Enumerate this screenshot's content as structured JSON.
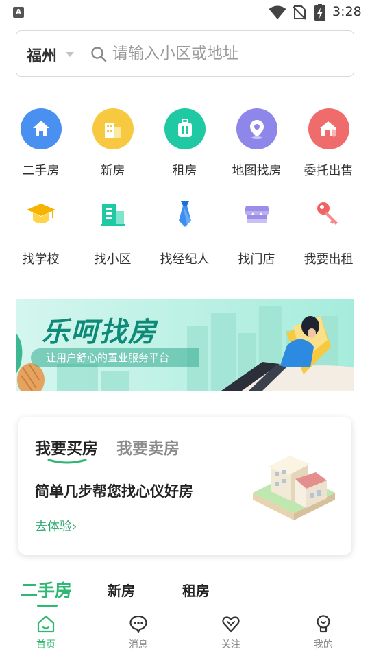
{
  "status_bar": {
    "time": "3:28",
    "app_badge": "A"
  },
  "search": {
    "city": "福州",
    "placeholder": "请输入小区或地址"
  },
  "categories": [
    {
      "label": "二手房",
      "icon": "house-icon",
      "color": "#4a90f0"
    },
    {
      "label": "新房",
      "icon": "building-icon",
      "color": "#f7c940"
    },
    {
      "label": "租房",
      "icon": "luggage-icon",
      "color": "#1ec9a3"
    },
    {
      "label": "地图找房",
      "icon": "map-pin-icon",
      "color": "#8e86e8"
    },
    {
      "label": "委托出售",
      "icon": "house-shield-icon",
      "color": "#f06b6b"
    },
    {
      "label": "找学校",
      "icon": "graduation-cap-icon",
      "color": "#f5b400"
    },
    {
      "label": "找小区",
      "icon": "apartment-icon",
      "color": "#1ec9a3"
    },
    {
      "label": "找经纪人",
      "icon": "tie-icon",
      "color": "#3c8ef0"
    },
    {
      "label": "找门店",
      "icon": "storefront-icon",
      "color": "#9b8ee8"
    },
    {
      "label": "我要出租",
      "icon": "key-icon",
      "color": "#f26262"
    }
  ],
  "banner": {
    "title": "乐呵找房",
    "subtitle": "让用户舒心的置业服务平台"
  },
  "card": {
    "tab_buy": "我要买房",
    "tab_sell": "我要卖房",
    "headline": "简单几步帮您找心仪好房",
    "link": "去体验",
    "link_arrow": "›"
  },
  "house_tabs": [
    "二手房",
    "新房",
    "租房"
  ],
  "bottom_nav": [
    {
      "label": "首页",
      "icon": "home-icon",
      "active": true
    },
    {
      "label": "消息",
      "icon": "message-icon",
      "active": false
    },
    {
      "label": "关注",
      "icon": "heart-icon",
      "active": false
    },
    {
      "label": "我的",
      "icon": "profile-icon",
      "active": false
    }
  ],
  "colors": {
    "accent": "#2eb872",
    "banner_bg": "#c6f3ea",
    "link": "#2eaa72"
  }
}
